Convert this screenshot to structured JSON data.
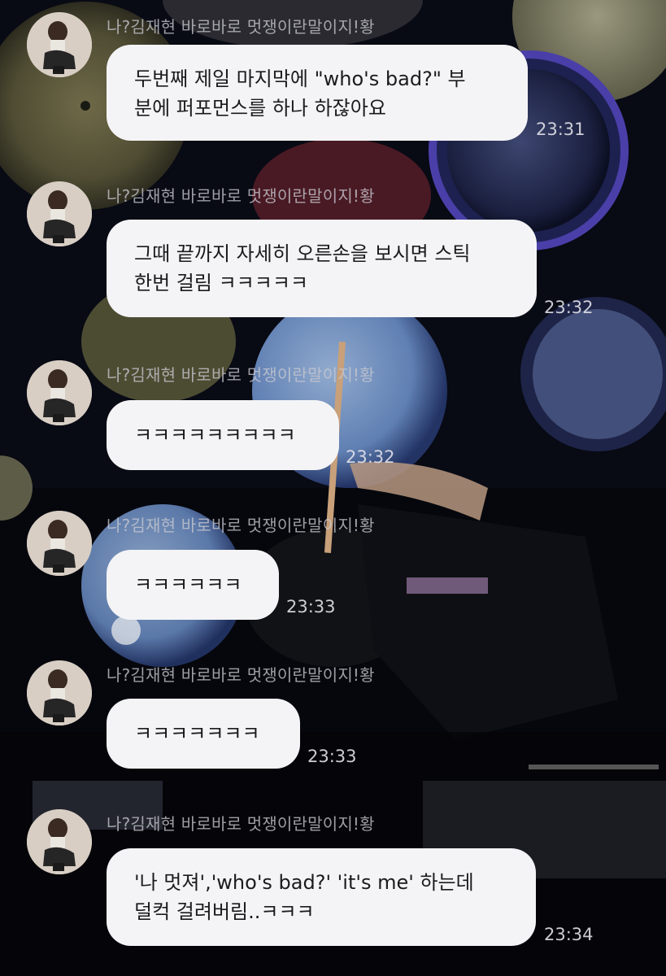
{
  "theme": {
    "bubble_color": "#f4f4f6",
    "text_color": "#1b1b1d",
    "name_color": "#c8c8d0",
    "time_color": "#e1e1e8"
  },
  "messages": [
    {
      "sender": "나?김재현 바로바로 멋쟁이란말이지!황",
      "lines": [
        "두번째 제일 마지막에 \"who's bad?\" 부",
        "분에 퍼포먼스를 하나 하잖아요"
      ],
      "time": "23:31"
    },
    {
      "sender": "나?김재현 바로바로 멋쟁이란말이지!황",
      "lines": [
        "그때 끝까지 자세히 오른손을 보시면 스틱",
        "한번 걸림 ㅋㅋㅋㅋㅋ"
      ],
      "time": "23:32"
    },
    {
      "sender": "나?김재현 바로바로 멋쟁이란말이지!황",
      "lines": [
        "ㅋㅋㅋㅋㅋㅋㅋㅋㅋ"
      ],
      "time": "23:32"
    },
    {
      "sender": "나?김재현 바로바로 멋쟁이란말이지!황",
      "lines": [
        "ㅋㅋㅋㅋㅋㅋ"
      ],
      "time": "23:33"
    },
    {
      "sender": "나?김재현 바로바로 멋쟁이란말이지!황",
      "lines": [
        "ㅋㅋㅋㅋㅋㅋㅋ"
      ],
      "time": "23:33"
    },
    {
      "sender": "나?김재현 바로바로 멋쟁이란말이지!황",
      "lines": [
        "'나 멋져','who's bad?' 'it's me' 하는데",
        "덜컥 걸려버림..ㅋㅋㅋ"
      ],
      "time": "23:34"
    }
  ]
}
